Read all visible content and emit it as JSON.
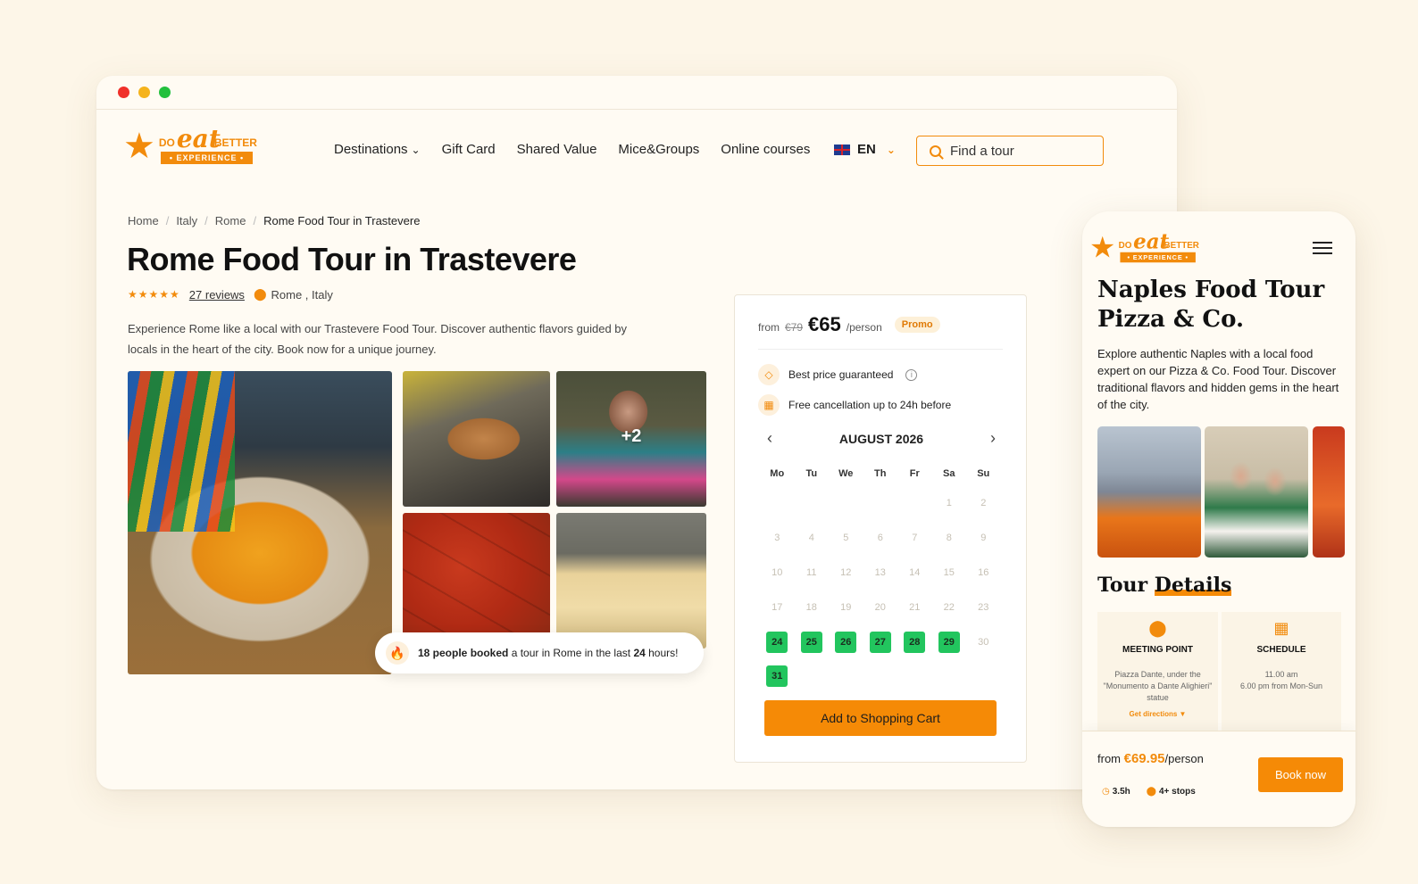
{
  "desktop": {
    "logo": {
      "do": "DO",
      "eat": "eat",
      "better": "BETTER",
      "experience": "• EXPERIENCE •"
    },
    "nav": {
      "destinations": "Destinations",
      "gift_card": "Gift Card",
      "shared_value": "Shared Value",
      "mice_groups": "Mice&Groups",
      "online_courses": "Online courses"
    },
    "language": "EN",
    "search": {
      "placeholder": "Find a tour"
    },
    "breadcrumb": [
      "Home",
      "Italy",
      "Rome",
      "Rome Food Tour in Trastevere"
    ],
    "title": "Rome Food Tour in Trastevere",
    "rating": {
      "stars": "★★★★★",
      "reviews": "27 reviews",
      "location": "Rome , Italy"
    },
    "description": "Experience Rome like a local with our Trastevere Food Tour. Discover authentic flavors guided by locals in the heart of the city. Book now for a unique journey.",
    "gallery": {
      "more_count": "+2"
    },
    "booked": {
      "bold1": "18 people booked",
      "mid": " a tour in Rome in the last ",
      "bold2": "24",
      "end": " hours!"
    },
    "booking": {
      "from": "from",
      "old_price": "€79",
      "price": "€65",
      "per": "/person",
      "promo": "Promo",
      "feature_best_price": "Best price guaranteed",
      "feature_cancel": "Free cancellation up to 24h before",
      "month": "AUGUST 2026",
      "weekdays": [
        "Mo",
        "Tu",
        "We",
        "Th",
        "Fr",
        "Sa",
        "Su"
      ],
      "days": [
        {
          "d": "",
          "a": false
        },
        {
          "d": "",
          "a": false
        },
        {
          "d": "",
          "a": false
        },
        {
          "d": "",
          "a": false
        },
        {
          "d": "",
          "a": false
        },
        {
          "d": "1",
          "a": false
        },
        {
          "d": "2",
          "a": false
        },
        {
          "d": "3",
          "a": false
        },
        {
          "d": "4",
          "a": false
        },
        {
          "d": "5",
          "a": false
        },
        {
          "d": "6",
          "a": false
        },
        {
          "d": "7",
          "a": false
        },
        {
          "d": "8",
          "a": false
        },
        {
          "d": "9",
          "a": false
        },
        {
          "d": "10",
          "a": false
        },
        {
          "d": "11",
          "a": false
        },
        {
          "d": "12",
          "a": false
        },
        {
          "d": "13",
          "a": false
        },
        {
          "d": "14",
          "a": false
        },
        {
          "d": "15",
          "a": false
        },
        {
          "d": "16",
          "a": false
        },
        {
          "d": "17",
          "a": false
        },
        {
          "d": "18",
          "a": false
        },
        {
          "d": "19",
          "a": false
        },
        {
          "d": "20",
          "a": false
        },
        {
          "d": "21",
          "a": false
        },
        {
          "d": "22",
          "a": false
        },
        {
          "d": "23",
          "a": false
        },
        {
          "d": "24",
          "a": true
        },
        {
          "d": "25",
          "a": true
        },
        {
          "d": "26",
          "a": true
        },
        {
          "d": "27",
          "a": true
        },
        {
          "d": "28",
          "a": true
        },
        {
          "d": "29",
          "a": true
        },
        {
          "d": "30",
          "a": false
        },
        {
          "d": "31",
          "a": true
        }
      ],
      "cart_button": "Add to Shopping Cart"
    }
  },
  "mobile": {
    "logo": {
      "do": "DO",
      "eat": "eat",
      "better": "BETTER",
      "experience": "• EXPERIENCE •"
    },
    "title": "Naples Food Tour Pizza & Co.",
    "description": "Explore authentic Naples with a local food expert on our Pizza & Co. Food Tour. Discover traditional flavors and hidden gems in the heart of the city.",
    "section_title_1": "Tour ",
    "section_title_2": "Details",
    "meeting": {
      "title": "MEETING POINT",
      "text": "Piazza Dante, under the \"Monumento a Dante Alighieri\" statue",
      "link": "Get directions ▼"
    },
    "schedule": {
      "title": "SCHEDULE",
      "line1": "11.00 am",
      "line2": "6.00 pm from Mon-Sun"
    },
    "bottom": {
      "from": "from ",
      "price": "€69.95",
      "per": "/person",
      "duration": "3.5h",
      "stops": "4+ stops",
      "book_button": "Book now"
    }
  },
  "colors": {
    "accent": "#f58a06",
    "available": "#22c55e",
    "background": "#fdf6e8"
  }
}
